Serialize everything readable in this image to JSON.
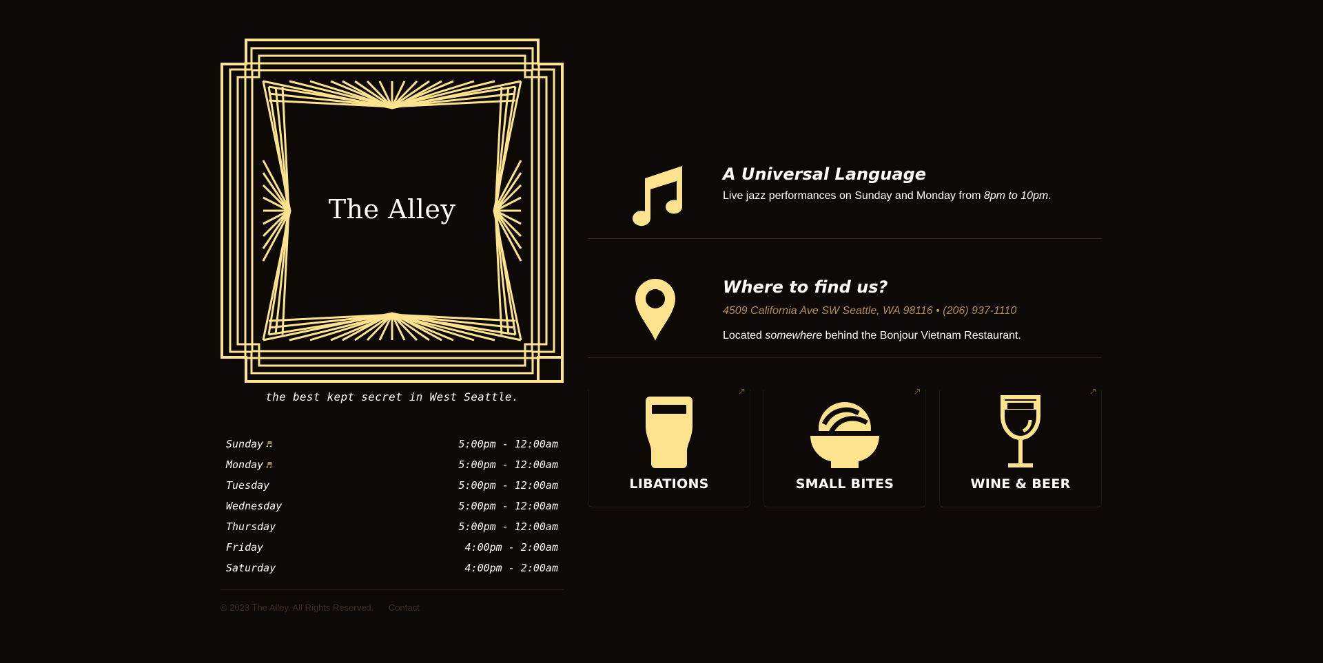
{
  "brand": {
    "name": "The Alley",
    "tagline": "the best kept secret in West Seattle."
  },
  "colors": {
    "background": "#0c0906",
    "gold": "#fde38e",
    "address": "#b38a4f",
    "footer": "#3a2e22"
  },
  "hours": [
    {
      "day": "Sunday",
      "music": true,
      "time": "5:00pm - 12:00am"
    },
    {
      "day": "Monday",
      "music": true,
      "time": "5:00pm - 12:00am"
    },
    {
      "day": "Tuesday",
      "music": false,
      "time": "5:00pm - 12:00am"
    },
    {
      "day": "Wednesday",
      "music": false,
      "time": "5:00pm - 12:00am"
    },
    {
      "day": "Thursday",
      "music": false,
      "time": "5:00pm - 12:00am"
    },
    {
      "day": "Friday",
      "music": false,
      "time": "4:00pm - 2:00am"
    },
    {
      "day": "Saturday",
      "music": false,
      "time": "4:00pm - 2:00am"
    }
  ],
  "music_note": "♬",
  "footer": {
    "copyright": "© 2023 The Alley. All Rights Reserved.",
    "contact_label": "Contact"
  },
  "jazz": {
    "icon": "music-note-icon",
    "heading": "A Universal Language",
    "text_before": "Live jazz performances on Sunday and Monday from ",
    "text_em": "8pm to 10pm",
    "text_after": "."
  },
  "location": {
    "icon": "map-pin-icon",
    "heading": "Where to find us?",
    "address": "4509 California Ave SW Seattle, WA 98116 • (206) 937-1110",
    "text_before": "Located ",
    "text_em": "somewhere",
    "text_after": " behind the Bonjour Vietnam Restaurant."
  },
  "menu_cards": [
    {
      "label": "LIBATIONS",
      "icon": "pint-glass-icon",
      "arrow": "↗"
    },
    {
      "label": "SMALL BITES",
      "icon": "bowl-icon",
      "arrow": "↗"
    },
    {
      "label": "WINE & BEER",
      "icon": "wine-glass-icon",
      "arrow": "↗"
    }
  ]
}
